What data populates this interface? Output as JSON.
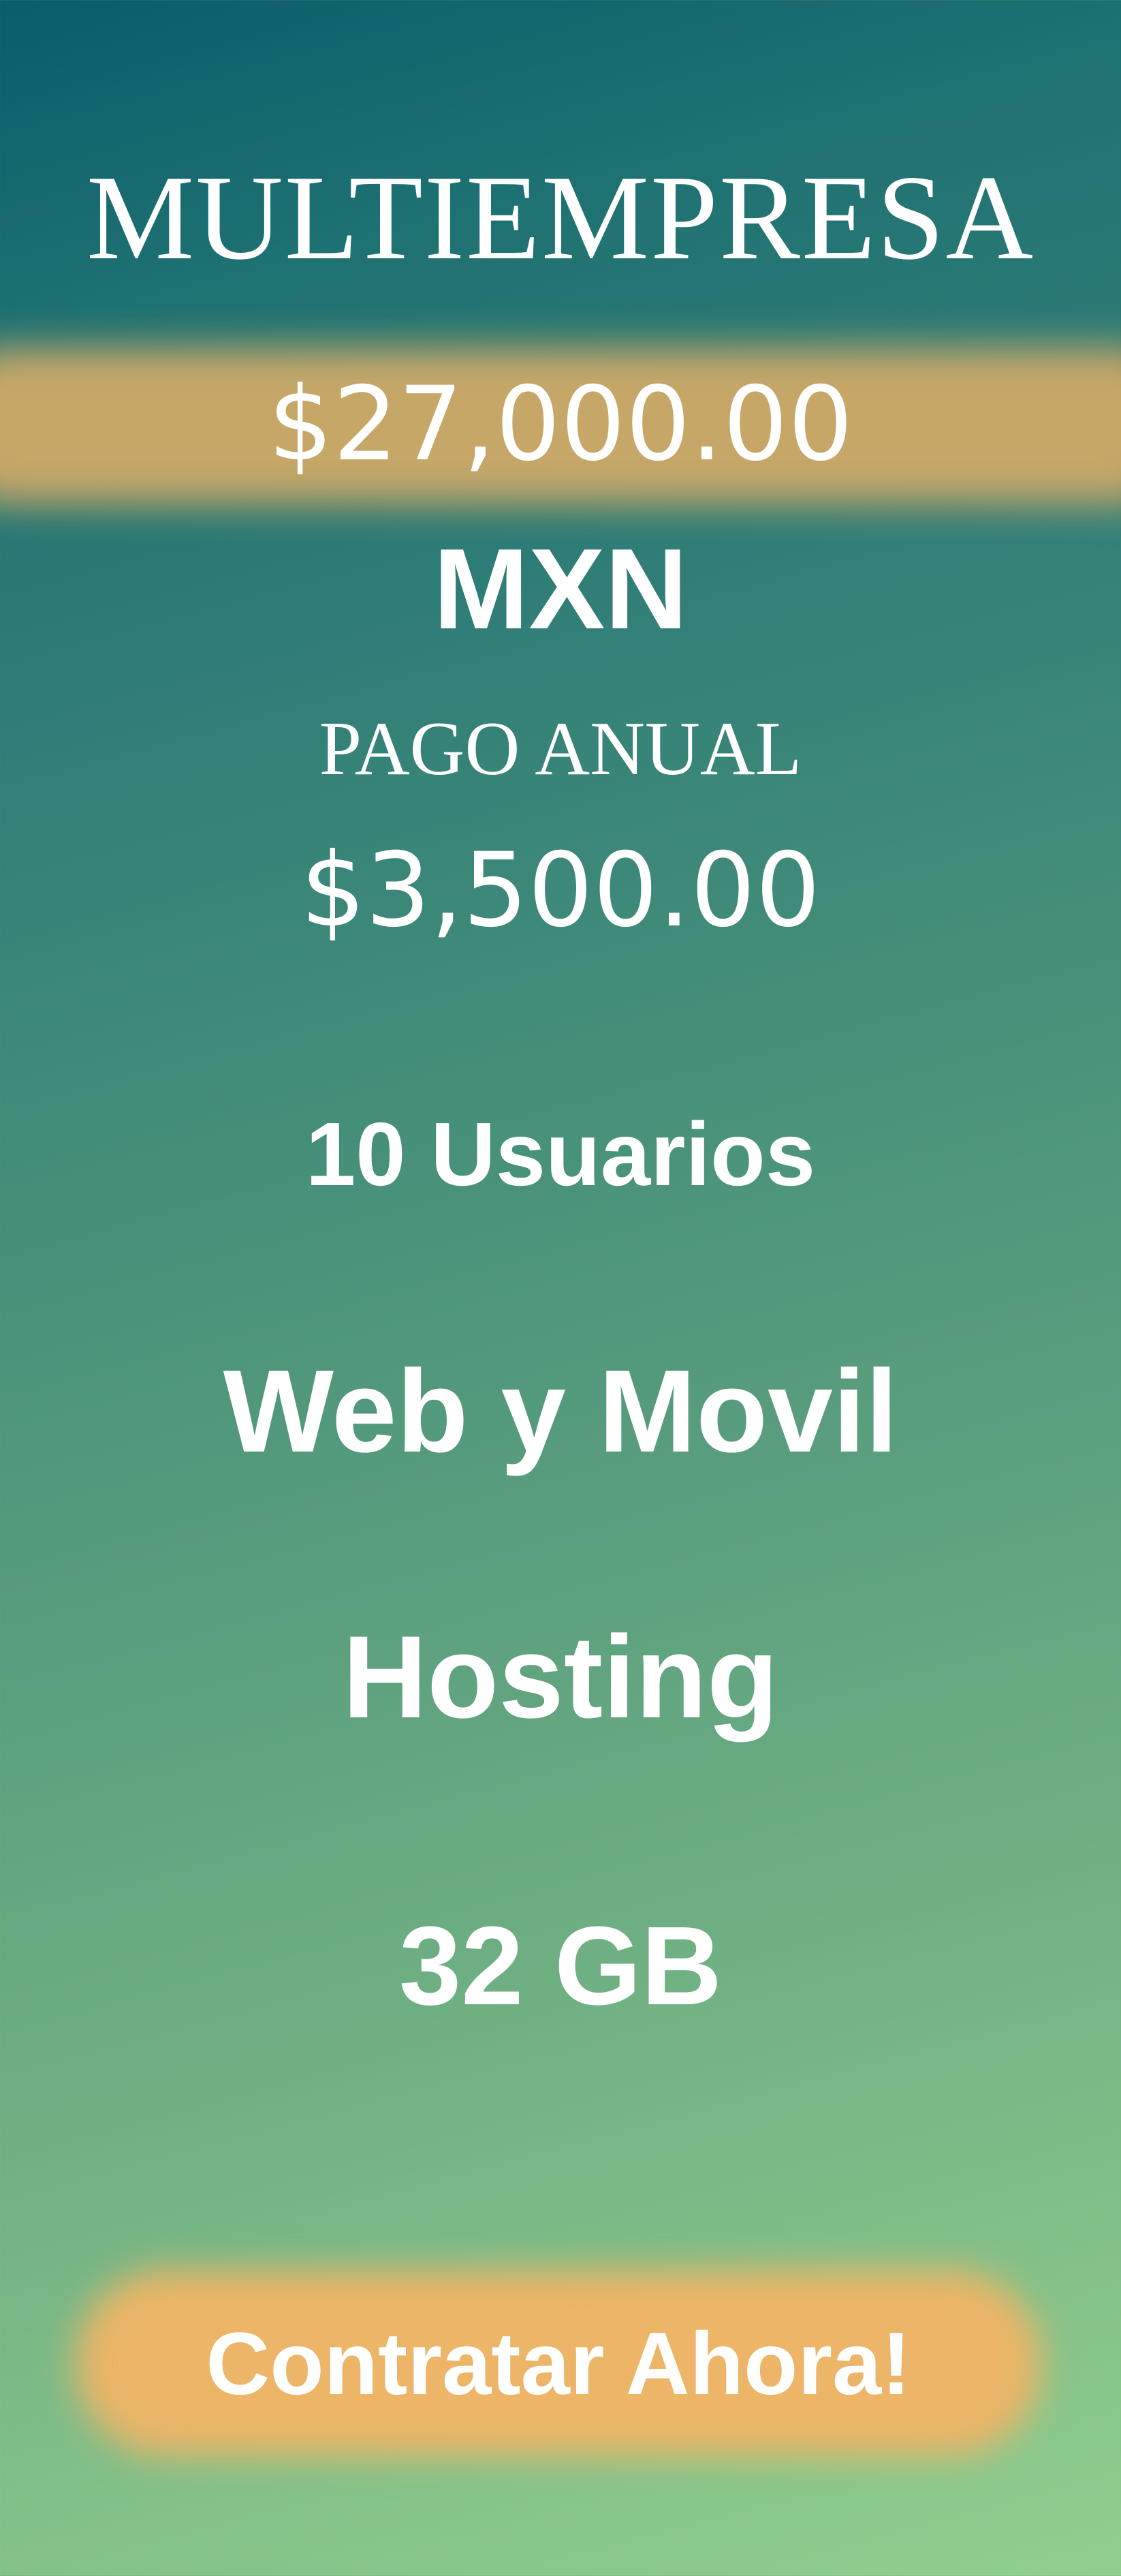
{
  "plan": {
    "title": "MULTIEMPRESA",
    "price": "$27,000.00",
    "currency": "MXN",
    "annual_label": "PAGO ANUAL",
    "annual_price": "$3,500.00"
  },
  "features": {
    "users": "10 Usuarios",
    "platforms": "Web y Movil",
    "hosting": "Hosting",
    "storage": "32 GB"
  },
  "cta": {
    "label": "Contratar Ahora!"
  },
  "colors": {
    "band": "#c6a768",
    "cta": "#ecb567",
    "gradient_top": "#0b5c6b",
    "gradient_bottom": "#90cf8e"
  }
}
